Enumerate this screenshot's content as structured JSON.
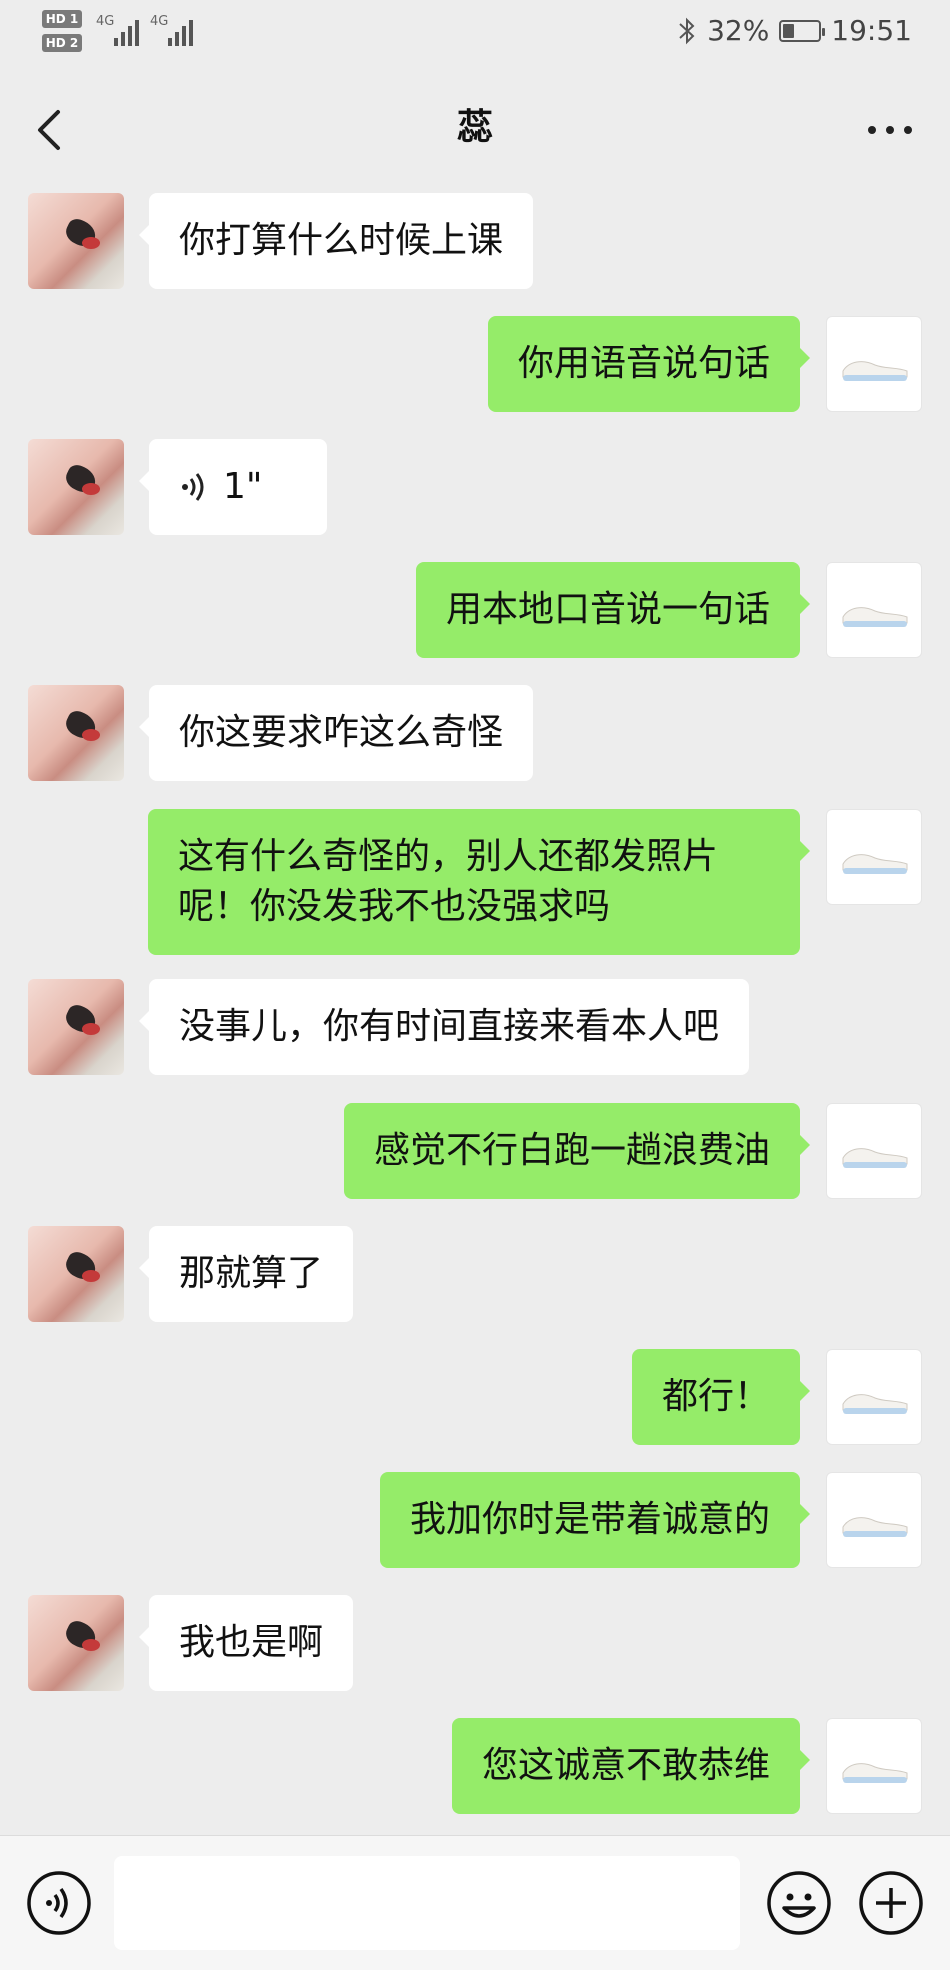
{
  "status_bar": {
    "sim1_label": "HD 1",
    "sim2_label": "HD 2",
    "network1": "4G",
    "network2": "4G",
    "battery_percent": "32%",
    "time": "19:51",
    "battery_level": 0.32
  },
  "header": {
    "title": "蕊"
  },
  "messages": [
    {
      "side": "left",
      "text": "你打算什么时候上课"
    },
    {
      "side": "right",
      "text": "你用语音说句话"
    },
    {
      "side": "left",
      "type": "voice",
      "text": "1\""
    },
    {
      "side": "right",
      "text": "用本地口音说一句话"
    },
    {
      "side": "left",
      "text": "你这要求咋这么奇怪"
    },
    {
      "side": "right",
      "text": "这有什么奇怪的，别人还都发照片呢！你没发我不也没强求吗"
    },
    {
      "side": "left",
      "text": "没事儿，你有时间直接来看本人吧"
    },
    {
      "side": "right",
      "text": "感觉不行白跑一趟浪费油"
    },
    {
      "side": "left",
      "text": "那就算了"
    },
    {
      "side": "right",
      "text": "都行！"
    },
    {
      "side": "right",
      "text": "我加你时是带着诚意的"
    },
    {
      "side": "left",
      "text": "我也是啊"
    },
    {
      "side": "right",
      "text": "您这诚意不敢恭维"
    }
  ],
  "input": {
    "value": ""
  },
  "icons": {
    "back": "chevron-left-icon",
    "more": "more-dots-icon",
    "voice": "voice-input-icon",
    "emoji": "emoji-icon",
    "plus": "plus-icon"
  }
}
